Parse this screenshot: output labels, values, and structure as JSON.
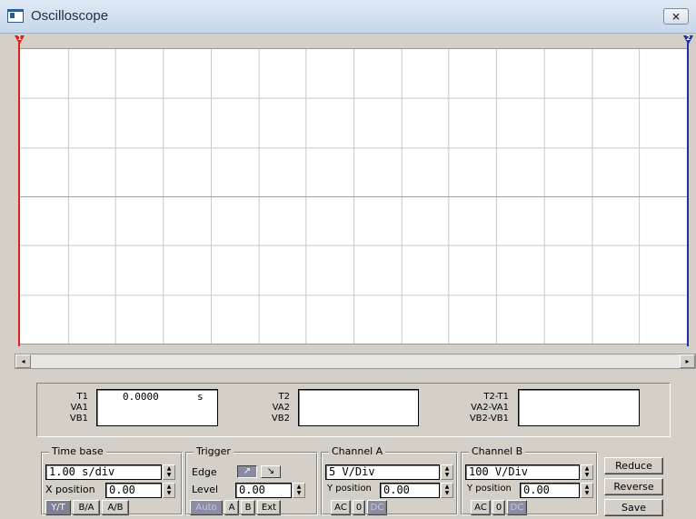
{
  "window": {
    "title": "Oscilloscope",
    "close_label": "⨯"
  },
  "screen": {
    "grid_cols": 14,
    "grid_rows": 6,
    "grid_color": "#c9c9c9",
    "center_color": "#a0a0a0",
    "cursor_a_label": "1",
    "cursor_b_label": "2",
    "cursor_a_color": "#e02020",
    "cursor_b_color": "#1f2ea8"
  },
  "scrollbar": {
    "left_arrow": "◂",
    "right_arrow": "▸"
  },
  "readout": {
    "t1": {
      "label_t": "T1",
      "label_va": "VA1",
      "label_vb": "VB1",
      "value": "0.0000",
      "unit": "s"
    },
    "t2": {
      "label_t": "T2",
      "label_va": "VA2",
      "label_vb": "VB2"
    },
    "diff": {
      "label_t": "T2-T1",
      "label_va": "VA2-VA1",
      "label_vb": "VB2-VB1"
    }
  },
  "timebase": {
    "title": "Time base",
    "scale": "1.00 s/div",
    "xpos_label": "X position",
    "xpos_value": "0.00",
    "modes": [
      "Y/T",
      "B/A",
      "A/B"
    ],
    "active_mode": "Y/T"
  },
  "trigger": {
    "title": "Trigger",
    "edge_label": "Edge",
    "level_label": "Level",
    "level_value": "0.00",
    "edge_rise": "↗",
    "edge_fall": "↘",
    "sources": [
      "Auto",
      "A",
      "B",
      "Ext"
    ],
    "active_source": "Auto"
  },
  "channel_a": {
    "title": "Channel A",
    "scale": "5 V/Div",
    "ypos_label": "Y position",
    "ypos_value": "0.00",
    "couplings": [
      "AC",
      "0",
      "DC"
    ],
    "active_coupling": "DC"
  },
  "channel_b": {
    "title": "Channel B",
    "scale": "100 V/Div",
    "ypos_label": "Y position",
    "ypos_value": "0.00",
    "couplings": [
      "AC",
      "0",
      "DC"
    ],
    "active_coupling": "DC"
  },
  "side_buttons": {
    "reduce": "Reduce",
    "reverse": "Reverse",
    "save": "Save"
  },
  "spin_up": "▲",
  "spin_down": "▼"
}
